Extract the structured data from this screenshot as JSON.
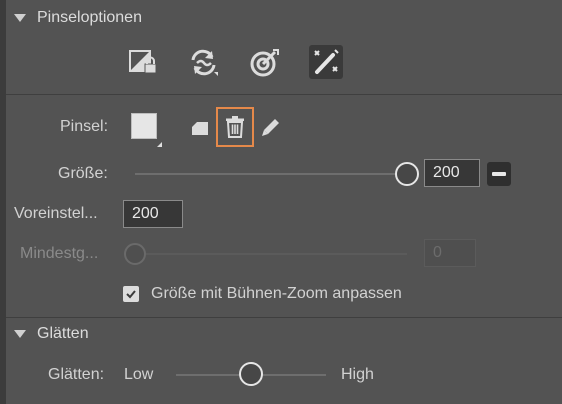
{
  "brush_options": {
    "title": "Pinseloptionen",
    "tools": [
      {
        "name": "lock-transparency-icon",
        "active": false
      },
      {
        "name": "sync-mode-icon",
        "active": false
      },
      {
        "name": "target-icon",
        "active": false
      },
      {
        "name": "magic-wand-icon",
        "active": true
      }
    ],
    "brush_label": "Pinsel:",
    "size_label": "Größe:",
    "size_value": "200",
    "size_fraction": 1.0,
    "preset_label": "Voreinstel...",
    "preset_value": "200",
    "min_size_label": "Mindestg...",
    "min_size_value": "0",
    "min_size_fraction": 0.0,
    "zoom_checkbox_label": "Größe mit Bühnen-Zoom anpassen",
    "zoom_checked": true
  },
  "smoothing": {
    "title": "Glätten",
    "label": "Glätten:",
    "low_label": "Low",
    "high_label": "High",
    "fraction": 0.5
  },
  "colors": {
    "panel_bg": "#535353",
    "highlight": "#e5894a"
  }
}
